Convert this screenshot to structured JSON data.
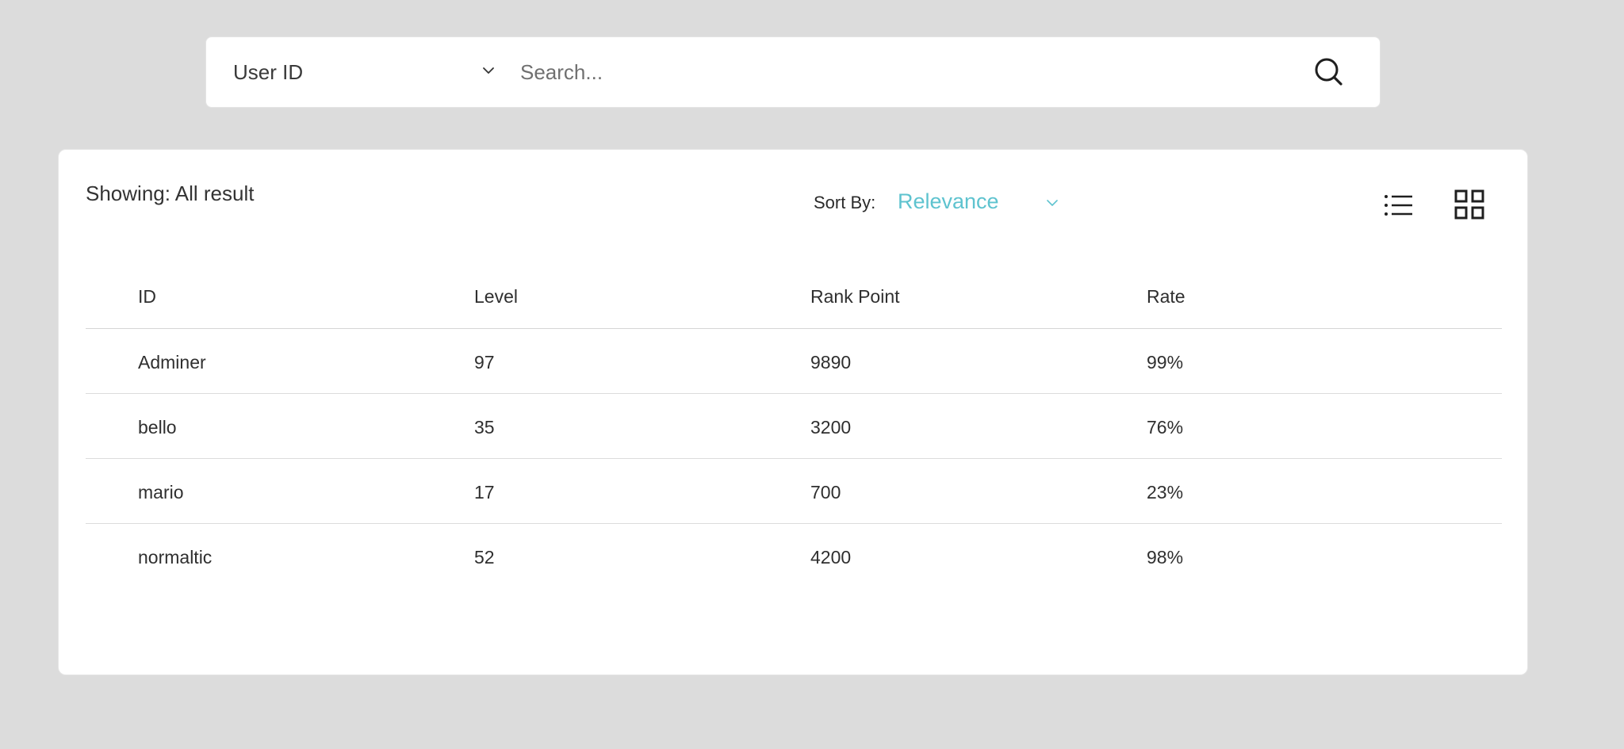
{
  "search": {
    "field_selected": "User ID",
    "placeholder": "Search..."
  },
  "results": {
    "showing_text": "Showing: All result",
    "sort_label": "Sort By:",
    "sort_value": "Relevance",
    "accent_color": "#5ec3cf"
  },
  "icons": {
    "field_chevron": "chevron-down-icon",
    "search": "search-icon",
    "sort_chevron": "chevron-down-icon",
    "list_view": "list-view-icon",
    "grid_view": "grid-view-icon"
  },
  "table": {
    "headers": [
      "ID",
      "Level",
      "Rank Point",
      "Rate"
    ],
    "rows": [
      [
        "Adminer",
        "97",
        "9890",
        "99%"
      ],
      [
        "bello",
        "35",
        "3200",
        "76%"
      ],
      [
        "mario",
        "17",
        "700",
        "23%"
      ],
      [
        "normaltic",
        "52",
        "4200",
        "98%"
      ]
    ]
  }
}
